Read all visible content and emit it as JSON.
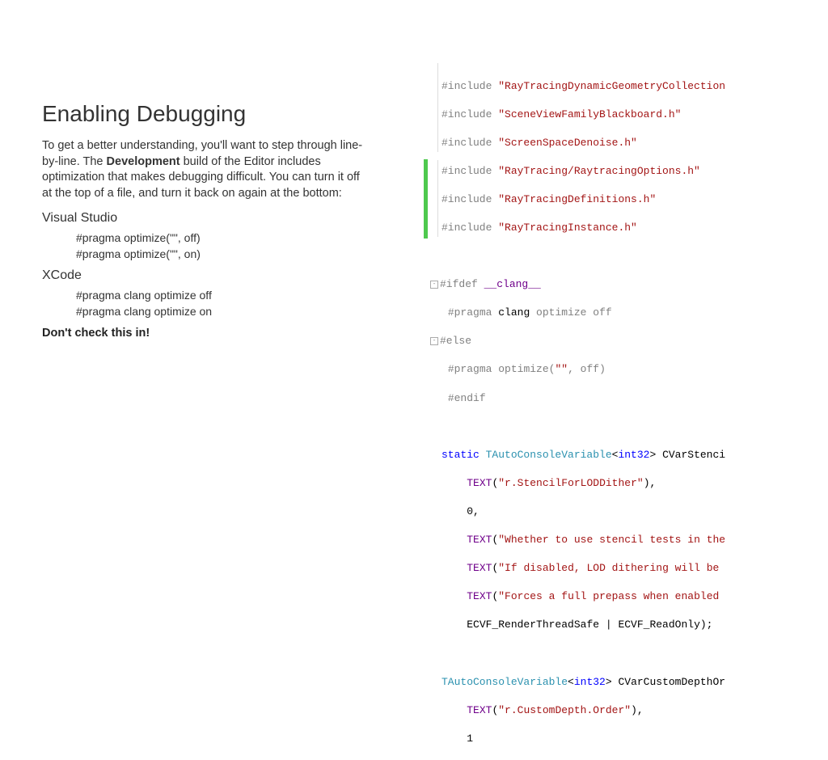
{
  "heading": "Enabling Debugging",
  "body_before": "To get a better understanding, you'll want to step through line-by-line. The ",
  "body_bold": "Development",
  "body_after": " build of the Editor includes optimization that makes debugging difficult. You can turn it off at the top of a file, and turn it back on again at the bottom:",
  "vs_label": "Visual Studio",
  "vs_lines": {
    "a": "#pragma optimize(\"\", off)",
    "b": "#pragma optimize(\"\", on)"
  },
  "xcode_label": "XCode",
  "xcode_lines": {
    "a": "#pragma clang optimize off",
    "b": "#pragma clang optimize on"
  },
  "warning": "Don't check this in!",
  "code": {
    "inc_kw": "#include ",
    "includes": {
      "a": "\"RayTracingDynamicGeometryCollection",
      "b": "\"SceneViewFamilyBlackboard.h\"",
      "c": "\"ScreenSpaceDenoise.h\"",
      "d": "\"RayTracing/RaytracingOptions.h\"",
      "e": "\"RayTracingDefinitions.h\"",
      "f": "\"RayTracingInstance.h\""
    },
    "ifdef": "#ifdef ",
    "clang_macro": "__clang__",
    "pragma1_a": "#pragma ",
    "pragma1_b": "clang",
    "pragma1_c": " optimize off",
    "else": "#else",
    "pragma2_a": "#pragma ",
    "pragma2_b": "optimize(",
    "pragma2_c": "\"\"",
    "pragma2_d": ", off)",
    "endif": "#endif",
    "static": "static ",
    "tauto": "TAutoConsoleVariable",
    "int32": "int32",
    "cvars": "> CVarStenci",
    "text_macro": "TEXT",
    "str1": "\"r.StencilForLODDither\"",
    "zero": "0,",
    "str2": "\"Whether to use stencil tests in the",
    "str3": "\"If disabled, LOD dithering will be ",
    "str4": "\"Forces a full prepass when enabled",
    "ecvf_a": "ECVF_RenderThreadSafe",
    "ecvf_b": "ECVF_ReadOnly",
    "cvars2": "> CVarCustomDepthOr",
    "str5": "\"r.CustomDepth.Order\"",
    "one": "1"
  }
}
